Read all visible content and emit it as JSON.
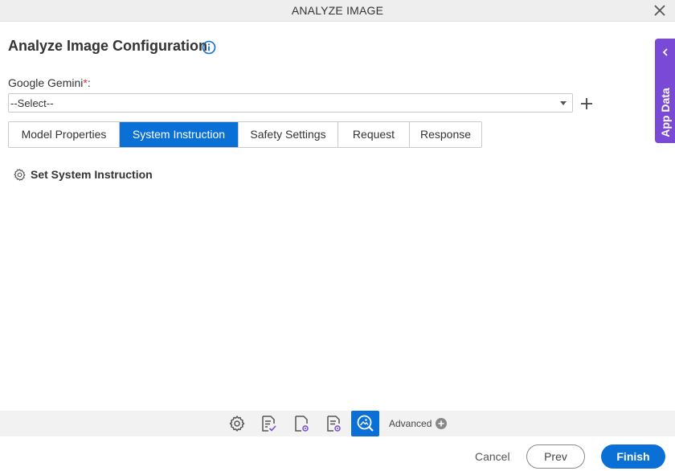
{
  "window": {
    "title": "ANALYZE IMAGE",
    "close_icon": "close-icon"
  },
  "main": {
    "heading": "Analyze Image Configuration",
    "info_icon": "info-icon"
  },
  "form": {
    "field_label": "Google Gemini",
    "required_marker": "*",
    "label_colon": ":",
    "select_value": "--Select--",
    "add_icon": "plus-icon"
  },
  "tabs": [
    {
      "label": "Model Properties",
      "active": false
    },
    {
      "label": "System Instruction",
      "active": true
    },
    {
      "label": "Safety Settings",
      "active": false
    },
    {
      "label": "Request",
      "active": false
    },
    {
      "label": "Response",
      "active": false
    }
  ],
  "content": {
    "set_label": "Set System Instruction",
    "set_icon": "gear-icon"
  },
  "side_panel": {
    "label": "App Data",
    "icon": "chevron-left-icon"
  },
  "toolbar": {
    "icons": [
      "gear-icon",
      "document-check-icon",
      "document-settings-icon",
      "document-gear-icon",
      "image-search-icon"
    ],
    "advanced_label": "Advanced",
    "advanced_icon": "plus-circle-icon"
  },
  "footer": {
    "cancel_label": "Cancel",
    "prev_label": "Prev",
    "finish_label": "Finish"
  },
  "colors": {
    "accent": "#0a70d6",
    "side_panel": "#7a4ad6",
    "required": "#d9302c"
  }
}
